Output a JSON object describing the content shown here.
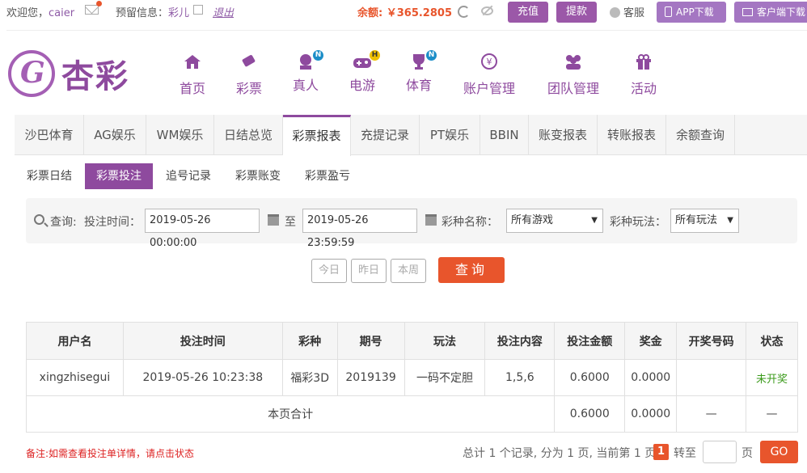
{
  "topbar": {
    "welcome_prefix": "欢迎您，",
    "username": "caier",
    "reserved_prefix": "预留信息：",
    "reserved_value": "彩儿",
    "logout": "退出",
    "balance_label": "余额:",
    "balance_value": "￥365.2805",
    "recharge": "充值",
    "withdraw": "提款",
    "customer_service": "客服",
    "app_download": "APP下载",
    "client_download": "客户端下载"
  },
  "logo": {
    "text": "杏彩"
  },
  "nav": [
    {
      "label": "首页",
      "icon": "home-icon"
    },
    {
      "label": "彩票",
      "icon": "lottery-ticket-icon"
    },
    {
      "label": "真人",
      "icon": "live-dealer-icon",
      "badge": "N"
    },
    {
      "label": "电游",
      "icon": "gamepad-icon",
      "badge": "H"
    },
    {
      "label": "体育",
      "icon": "trophy-icon",
      "badge": "N"
    },
    {
      "label": "账户管理",
      "icon": "account-yen-icon"
    },
    {
      "label": "团队管理",
      "icon": "team-icon"
    },
    {
      "label": "活动",
      "icon": "gift-icon"
    }
  ],
  "tabs": [
    "沙巴体育",
    "AG娱乐",
    "WM娱乐",
    "日结总览",
    "彩票报表",
    "充提记录",
    "PT娱乐",
    "BBIN",
    "账变报表",
    "转账报表",
    "余额查询"
  ],
  "active_tab": "彩票报表",
  "subtabs": [
    "彩票日结",
    "彩票投注",
    "追号记录",
    "彩票账变",
    "彩票盈亏"
  ],
  "active_subtab": "彩票投注",
  "filter": {
    "query_label": "查询:",
    "time_label": "投注时间：",
    "start": "2019-05-26 00:00:00",
    "to": "至",
    "end": "2019-05-26 23:59:59",
    "game_label": "彩种名称：",
    "game_value": "所有游戏",
    "play_label": "彩种玩法：",
    "play_value": "所有玩法"
  },
  "quick": {
    "today": "今日",
    "yesterday": "昨日",
    "week": "本周",
    "search": "查询"
  },
  "table": {
    "headers": [
      "用户名",
      "投注时间",
      "彩种",
      "期号",
      "玩法",
      "投注内容",
      "投注金额",
      "奖金",
      "开奖号码",
      "状态"
    ],
    "rows": [
      [
        "xingzhisegui",
        "2019-05-26 10:23:38",
        "福彩3D",
        "2019139",
        "一码不定胆",
        "1,5,6",
        "0.6000",
        "0.0000",
        "",
        "未开奖"
      ]
    ],
    "total_label": "本页合计",
    "total_amount": "0.6000",
    "total_prize": "0.0000",
    "total_draw": "—",
    "total_status": "—"
  },
  "note": "备注:如需查看投注单详情，请点击状态",
  "pager": {
    "summary": "总计 1 个记录, 分为 1 页, 当前第 1 页",
    "current": "1",
    "goto": "转至",
    "page_unit": "页",
    "go": "GO"
  },
  "colors": {
    "brand": "#8e4a9e",
    "accent": "#e8552c",
    "status_pending": "#3a9a1a"
  }
}
